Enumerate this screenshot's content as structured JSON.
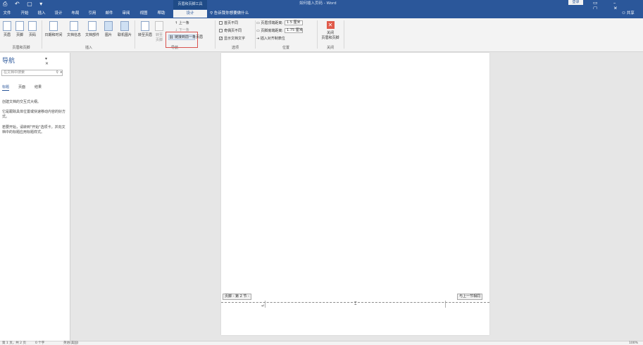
{
  "titlebar": {
    "qat": "⎙ ↶ ▢ ▾",
    "context_title": "页眉和页脚工具",
    "document_title": "如何插入页码 - Word",
    "login": "登录",
    "window_buttons": "▭ – ▢ ✕"
  },
  "tabs": [
    "文件",
    "开始",
    "插入",
    "设计",
    "布局",
    "引用",
    "邮件",
    "审阅",
    "视图",
    "帮助",
    "设计"
  ],
  "active_tab_index": 10,
  "tell_me": "告诉我你想要做什么",
  "share": "共享",
  "ribbon": {
    "buttons": [
      "页眉",
      "页脚",
      "页码",
      "日期和时间",
      "文档信息",
      "文档部件",
      "图片",
      "联机图片",
      "转至页眉",
      "转至页脚"
    ],
    "groups": {
      "header_footer": "页眉和页脚",
      "insert": "插入",
      "navigation": "导航",
      "options": "选项",
      "position": "位置",
      "close": "关闭"
    },
    "nav_prev": "上一条",
    "nav_next": "下一条",
    "link_to_previous": "链接到前一条页眉",
    "options": [
      {
        "label": "首页不同",
        "checked": false
      },
      {
        "label": "奇偶页不同",
        "checked": false
      },
      {
        "label": "显示文档文字",
        "checked": true
      }
    ],
    "position": {
      "header_label": "页眉顶端距离:",
      "header_value": "1.5 厘米",
      "footer_label": "页脚底端距离:",
      "footer_value": "1.75 厘米",
      "insert_tab": "插入对齐制表位"
    },
    "close": {
      "line1": "关闭",
      "line2": "页眉和页脚"
    }
  },
  "navpane": {
    "title": "导航",
    "controls": "▾ ✕",
    "search_placeholder": "在文档中搜索",
    "tabs": [
      "标题",
      "页面",
      "结果"
    ],
    "texts": [
      "创建文档的交互式大纲。",
      "它是跟踪具体位置或快速移动内容的好方式。",
      "若要开始，请转到\"开始\"选项卡，并向文档中的标题应用标题样式。"
    ]
  },
  "document": {
    "footer_label": "页脚 - 第 2 节 -",
    "same_as_previous": "与上一节相同",
    "cursor": "⌶",
    "para_mark": "↵"
  },
  "statusbar": {
    "page": "第 1 页，共 2 页",
    "words": "0 个字",
    "language": "英语(美国)",
    "zoom": "100%"
  },
  "colors": {
    "accent": "#2b579a",
    "ribbon_bg": "#f3f3f3",
    "highlight": "#d9534f"
  }
}
